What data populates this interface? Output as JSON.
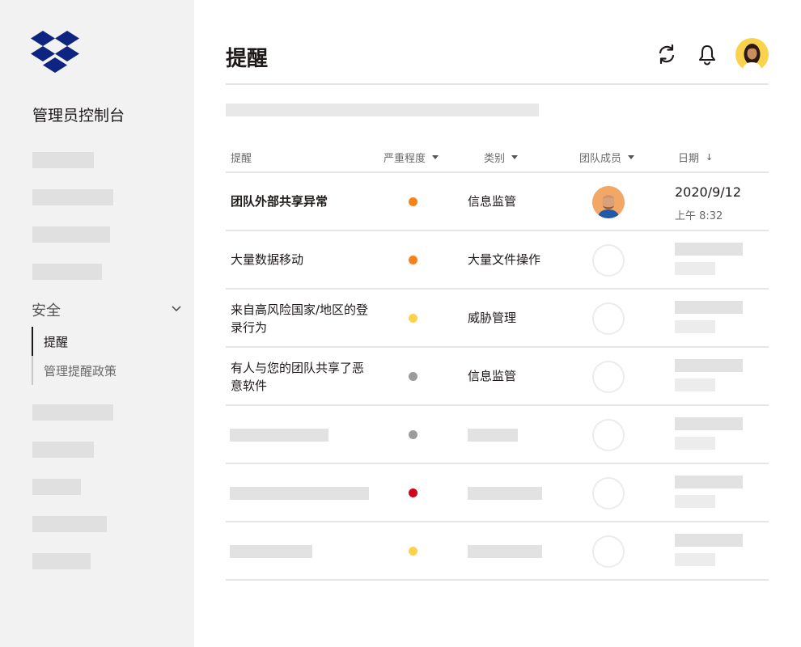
{
  "sidebar": {
    "console_title": "管理员控制台",
    "section": "安全",
    "sub_items": [
      {
        "label": "提醒",
        "active": true
      },
      {
        "label": "管理提醒政策",
        "active": false
      }
    ]
  },
  "header": {
    "title": "提醒",
    "icons": [
      "refresh-icon",
      "bell-icon",
      "user-avatar"
    ]
  },
  "table": {
    "columns": [
      "提醒",
      "严重程度",
      "类别",
      "团队成员",
      "日期"
    ],
    "rows": [
      {
        "name": "团队外部共享异常",
        "severity_color": "#f7821b",
        "category": "信息监管",
        "member": "avatar",
        "date": "2020/9/12",
        "time": "上午 8:32"
      },
      {
        "name": "大量数据移动",
        "severity_color": "#f7821b",
        "category": "大量文件操作",
        "member": "empty"
      },
      {
        "name": "来自高风险国家/地区的登录行为",
        "severity_color": "#fad24b",
        "category": "威胁管理",
        "member": "empty"
      },
      {
        "name": "有人与您的团队共享了恶意软件",
        "severity_color": "#9b9b9b",
        "category": "信息监管",
        "member": "empty"
      },
      {
        "name": "",
        "severity_color": "#9b9b9b",
        "category": "",
        "member": "empty"
      },
      {
        "name": "",
        "severity_color": "#d0021b",
        "category": "",
        "member": "empty"
      },
      {
        "name": "",
        "severity_color": "#fad24b",
        "category": "",
        "member": "empty"
      }
    ]
  },
  "colors": {
    "sidebar_bg": "#f2f2f2",
    "brand_blue": "#0d2481",
    "avatar_bg": "#fad24b"
  }
}
